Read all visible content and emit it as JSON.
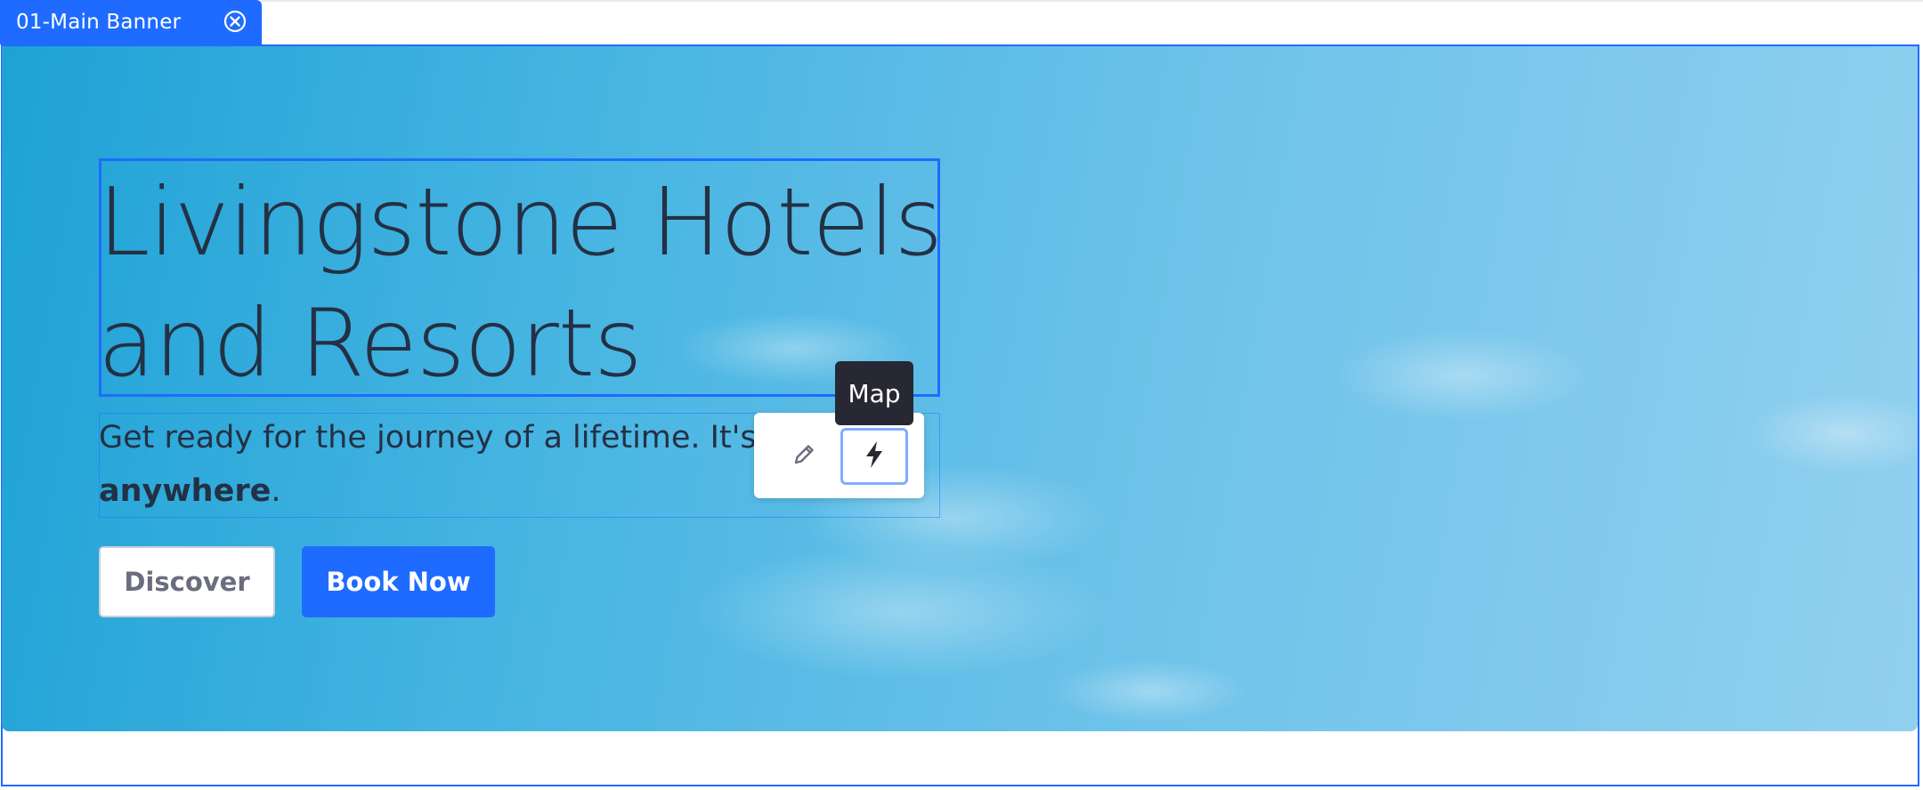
{
  "fragment": {
    "name": "01-Main Banner",
    "close_icon": "close-circle-icon",
    "accent_color": "#1f6bff"
  },
  "banner": {
    "title": "Livingstone Hotels and Resorts",
    "subtitle_prefix": "Get ready for the journey of a lifetime. It's ti",
    "subtitle_emphasis": "anywhere",
    "subtitle_suffix": ".",
    "buttons": {
      "discover": "Discover",
      "book_now": "Book Now"
    },
    "background_colors": [
      "#1ea2d6",
      "#92d0ef"
    ]
  },
  "toolbar": {
    "edit_icon": "pencil-icon",
    "map_icon": "bolt-icon",
    "tooltip": "Map"
  }
}
